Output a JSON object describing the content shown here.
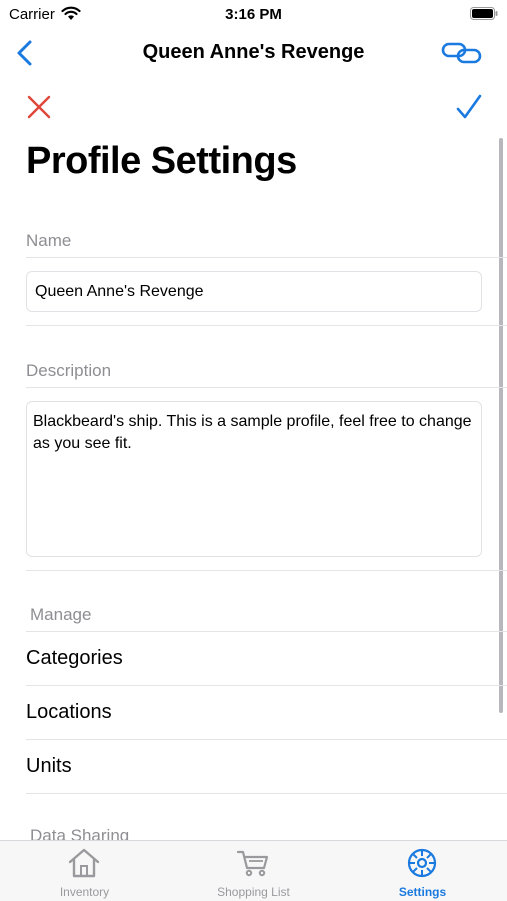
{
  "status_bar": {
    "carrier": "Carrier",
    "time": "3:16 PM"
  },
  "nav": {
    "title": "Queen Anne's Revenge"
  },
  "page": {
    "title": "Profile Settings"
  },
  "name_section": {
    "header": "Name",
    "value": "Queen Anne's Revenge"
  },
  "description_section": {
    "header": "Description",
    "value": "Blackbeard's ship. This is a sample profile, feel free to change as you see fit."
  },
  "manage_section": {
    "header": "Manage",
    "items": [
      {
        "label": "Categories"
      },
      {
        "label": "Locations"
      },
      {
        "label": "Units"
      }
    ]
  },
  "data_sharing_section": {
    "header": "Data Sharing"
  },
  "tab_bar": {
    "tabs": [
      {
        "label": "Inventory",
        "icon": "house-icon",
        "active": false
      },
      {
        "label": "Shopping List",
        "icon": "cart-icon",
        "active": false
      },
      {
        "label": "Settings",
        "icon": "gear-icon",
        "active": true
      }
    ]
  },
  "colors": {
    "accent": "#1a7ae0",
    "destructive": "#e0463a",
    "inactive_tab": "#9a9a9e",
    "section_header": "#8e8e93"
  }
}
